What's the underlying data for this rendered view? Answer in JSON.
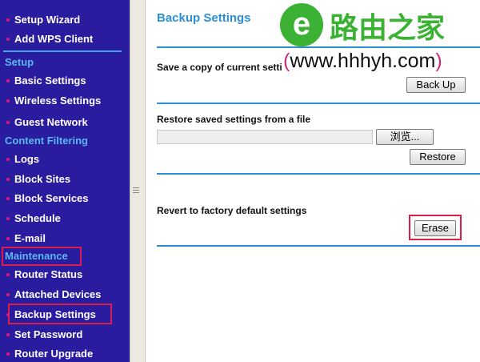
{
  "sidebar": {
    "items_top": [
      {
        "label": "Setup Wizard"
      },
      {
        "label": "Add WPS Client"
      }
    ],
    "sections": {
      "setup": "Setup",
      "content_filtering": "Content Filtering",
      "maintenance": "Maintenance"
    },
    "setup_items": [
      {
        "label": "Basic Settings"
      },
      {
        "label": "Wireless Settings"
      },
      {
        "label": "Guest Network"
      }
    ],
    "content_items": [
      {
        "label": "Logs"
      },
      {
        "label": "Block Sites"
      },
      {
        "label": "Block Services"
      },
      {
        "label": "Schedule"
      },
      {
        "label": "E-mail"
      }
    ],
    "maintenance_items": [
      {
        "label": "Router Status"
      },
      {
        "label": "Attached Devices"
      },
      {
        "label": "Backup Settings"
      },
      {
        "label": "Set Password"
      },
      {
        "label": "Router Upgrade"
      }
    ]
  },
  "main": {
    "title": "Backup Settings",
    "backup_label": "Save a copy of current settings",
    "backup_button": "Back Up",
    "restore_label": "Restore saved settings from a file",
    "browse_button": "浏览...",
    "restore_button": "Restore",
    "revert_label": "Revert to factory default settings",
    "erase_button": "Erase"
  },
  "watermark": {
    "logo_glyph": "e",
    "site_name": "路由之家",
    "url_open": "(",
    "url": "www.hhhyh.com",
    "url_close": ")"
  },
  "colors": {
    "sidebar_bg": "#2a1c9e",
    "section_text": "#59b8f2",
    "accent_blue": "#2b8fd4",
    "bullet": "#e0177f",
    "highlight_red": "#d8204a",
    "watermark_green": "#3bb234"
  }
}
